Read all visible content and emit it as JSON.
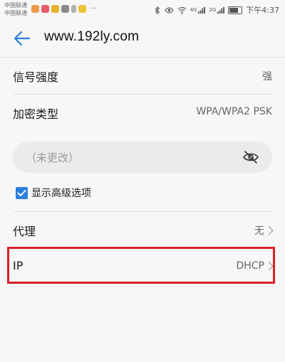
{
  "status_bar": {
    "carrier_1": "中国联通",
    "carrier_2": "中国联通",
    "more_dots": "···",
    "time": "下午4:37",
    "signal_1_label": "4G",
    "signal_2_label": "2G"
  },
  "header": {
    "title": "www.192ly.com"
  },
  "rows": {
    "signal_strength": {
      "label": "信号强度",
      "value": "强"
    },
    "encryption": {
      "label": "加密类型",
      "value": "WPA/WPA2 PSK"
    },
    "proxy": {
      "label": "代理",
      "value": "无"
    },
    "ip": {
      "label": "IP",
      "value": "DHCP"
    }
  },
  "password": {
    "placeholder": "（未更改）"
  },
  "advanced": {
    "label": "显示高级选项",
    "checked": true
  },
  "colors": {
    "accent": "#2a7fe0",
    "highlight": "#d6202a",
    "background": "#f7f7f7"
  }
}
